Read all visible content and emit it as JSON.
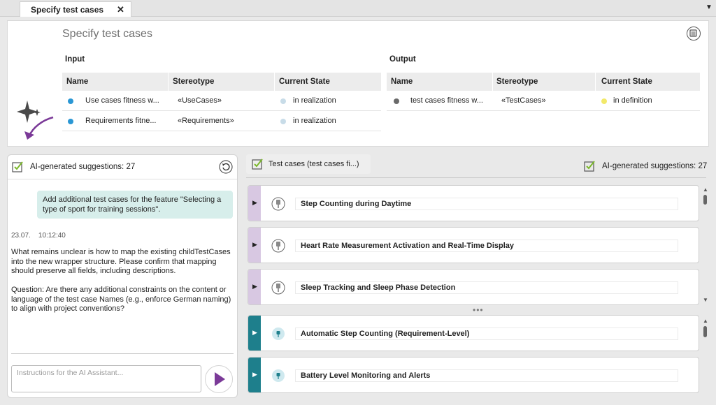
{
  "tab": {
    "title": "Specify test cases",
    "close": "✕",
    "menu": "▼"
  },
  "top": {
    "title": "Specify test cases",
    "input": {
      "label": "Input",
      "headers": {
        "name": "Name",
        "stereotype": "Stereotype",
        "state": "Current State"
      },
      "rows": [
        {
          "name": "Use cases fitness w...",
          "stereotype": "«UseCases»",
          "state": "in realization",
          "dot": "#2a97d4",
          "state_dot": "#c8dce8"
        },
        {
          "name": "Requirements fitne...",
          "stereotype": "«Requirements»",
          "state": "in realization",
          "dot": "#2a97d4",
          "state_dot": "#c8dce8"
        }
      ]
    },
    "output": {
      "label": "Output",
      "headers": {
        "name": "Name",
        "stereotype": "Stereotype",
        "state": "Current State"
      },
      "rows": [
        {
          "name": "test cases fitness w...",
          "stereotype": "«TestCases»",
          "state": "in definition",
          "dot": "#6a6a6a",
          "state_dot": "#f2e96a"
        }
      ]
    }
  },
  "chat": {
    "header": "AI-generated suggestions: 27",
    "user_message": "Add additional test cases for the feature \"Selecting a type of sport for training sessions\".",
    "timestamp": "23.07.    10:12:40",
    "reply": "What remains unclear is how to map the existing childTestCases into the new wrapper structure. Please confirm that mapping should preserve all fields, including descriptions.\n\nQuestion: Are there any additional constraints on the content or language of the test case Names (e.g., enforce German naming) to align with project conventions?",
    "input_placeholder": "Instructions for the AI Assistant..."
  },
  "right": {
    "tab_label": "Test cases (test cases fi...)",
    "suggestions_label": "AI-generated suggestions: 27",
    "ellipsis": "•••",
    "group1": [
      {
        "title": "Step Counting during Daytime"
      },
      {
        "title": "Heart Rate Measurement Activation and Real-Time Display"
      },
      {
        "title": "Sleep Tracking and Sleep Phase Detection"
      }
    ],
    "group2": [
      {
        "title": "Automatic Step Counting (Requirement-Level)"
      },
      {
        "title": "Battery Level Monitoring and Alerts"
      }
    ]
  },
  "colors": {
    "accent_purple": "#7b3a98",
    "stripe_lilac": "#d8c8e2",
    "stripe_teal": "#1e7f8c",
    "bubble": "#d7eeeb",
    "check_green": "#7bb82b"
  }
}
